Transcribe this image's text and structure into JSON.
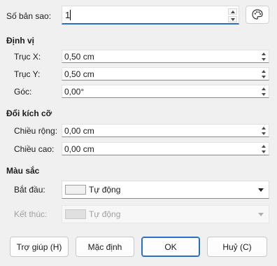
{
  "copies": {
    "label": "Số bản sao:",
    "value": "1"
  },
  "icons": {
    "copy_settings": "palette-icon"
  },
  "position": {
    "heading": "Định vị",
    "x": {
      "label": "Trục X:",
      "value": "0,50 cm"
    },
    "y": {
      "label": "Trục Y:",
      "value": "0,50 cm"
    },
    "angle": {
      "label": "Góc:",
      "value": "0,00°"
    }
  },
  "resize": {
    "heading": "Đổi kích cỡ",
    "width": {
      "label": "Chiều rộng:",
      "value": "0,00 cm"
    },
    "height": {
      "label": "Chiều cao:",
      "value": "0,00 cm"
    }
  },
  "colors": {
    "heading": "Màu sắc",
    "start": {
      "label": "Bắt đầu:",
      "value": "Tự động",
      "enabled": true
    },
    "end": {
      "label": "Kết thúc:",
      "value": "Tự động",
      "enabled": false
    }
  },
  "buttons": {
    "help": "Trợ giúp (H)",
    "reset": "Mặc định",
    "ok": "OK",
    "cancel": "Huỷ (C)"
  }
}
